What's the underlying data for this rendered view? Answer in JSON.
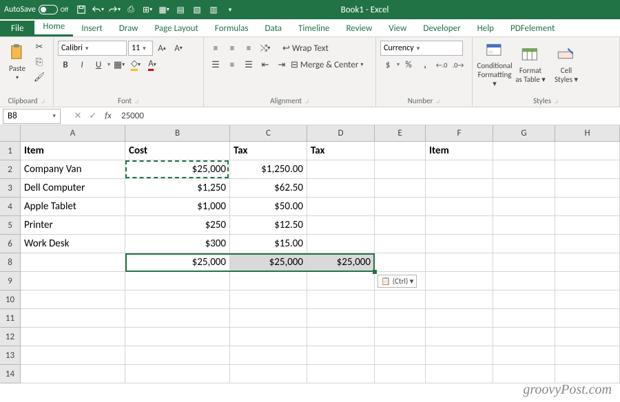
{
  "titlebar": {
    "autosave_label": "AutoSave",
    "autosave_state": "Off",
    "app_title": "Book1 - Excel"
  },
  "tabs": {
    "file": "File",
    "home": "Home",
    "insert": "Insert",
    "draw": "Draw",
    "layout": "Page Layout",
    "formulas": "Formulas",
    "data": "Data",
    "timeline": "Timeline",
    "review": "Review",
    "view": "View",
    "developer": "Developer",
    "help": "Help",
    "pdf": "PDFelement"
  },
  "ribbon": {
    "clipboard": {
      "paste": "Paste",
      "label": "Clipboard"
    },
    "font": {
      "name": "Calibri",
      "size": "11",
      "bold": "B",
      "italic": "I",
      "underline": "U",
      "label": "Font"
    },
    "alignment": {
      "wrap": "Wrap Text",
      "merge": "Merge & Center",
      "label": "Alignment"
    },
    "number": {
      "format": "Currency",
      "dollar": "$",
      "percent": "%",
      "comma": ",",
      "inc": ".0",
      "dec": ".00",
      "label": "Number"
    },
    "styles": {
      "cond": "Conditional Formatting ▾",
      "table": "Format as Table ▾",
      "cell": "Cell Styles ▾",
      "label": "Styles"
    }
  },
  "formula_bar": {
    "name_box": "B8",
    "cancel": "✕",
    "enter": "✓",
    "fx": "fx",
    "formula": "25000"
  },
  "columns": [
    "A",
    "B",
    "C",
    "D",
    "E",
    "F",
    "G",
    "H"
  ],
  "rows": [
    "1",
    "2",
    "3",
    "4",
    "5",
    "6",
    "8",
    "9",
    "10",
    "11",
    "12",
    "13",
    "14"
  ],
  "sheet": {
    "headers": {
      "A1": "Item",
      "B1": "Cost",
      "C1": "Tax",
      "D1": "Tax",
      "F1": "Item"
    },
    "data": [
      {
        "item": "Company Van",
        "cost": "$25,000",
        "tax": "$1,250.00"
      },
      {
        "item": "Dell Computer",
        "cost": "$1,250",
        "tax": "$62.50"
      },
      {
        "item": "Apple Tablet",
        "cost": "$1,000",
        "tax": "$50.00"
      },
      {
        "item": "Printer",
        "cost": "$250",
        "tax": "$12.50"
      },
      {
        "item": "Work Desk",
        "cost": "$300",
        "tax": "$15.00"
      }
    ],
    "row8": {
      "B": "$25,000",
      "C": "$25,000",
      "D": "$25,000"
    }
  },
  "paste_tip": "(Ctrl) ▾",
  "watermark": "groovyPost.com"
}
